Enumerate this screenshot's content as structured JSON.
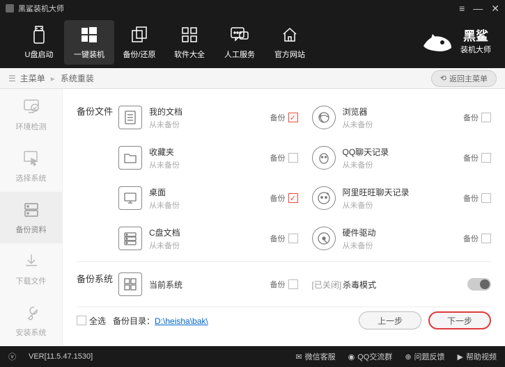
{
  "titlebar": {
    "title": "黑鲨装机大师"
  },
  "topnav": {
    "items": [
      {
        "label": "U盘启动"
      },
      {
        "label": "一键装机"
      },
      {
        "label": "备份/还原"
      },
      {
        "label": "软件大全"
      },
      {
        "label": "人工服务"
      },
      {
        "label": "官方网站"
      }
    ],
    "brand": "黑鲨",
    "brand_sub": "装机大师"
  },
  "breadcrumb": {
    "root": "主菜单",
    "current": "系统重装",
    "back": "返回主菜单"
  },
  "sidebar": {
    "items": [
      {
        "label": "环境检测"
      },
      {
        "label": "选择系统"
      },
      {
        "label": "备份资料"
      },
      {
        "label": "下载文件"
      },
      {
        "label": "安装系统"
      }
    ]
  },
  "sections": {
    "files_title": "备份文件",
    "system_title": "备份系统",
    "backup_label": "备份",
    "never": "从未备份",
    "left": [
      {
        "name": "我的文档",
        "checked": true
      },
      {
        "name": "收藏夹",
        "checked": false
      },
      {
        "name": "桌面",
        "checked": true
      },
      {
        "name": "C盘文档",
        "checked": false
      }
    ],
    "right": [
      {
        "name": "浏览器"
      },
      {
        "name": "QQ聊天记录"
      },
      {
        "name": "阿里旺旺聊天记录"
      },
      {
        "name": "硬件驱动"
      }
    ],
    "current_system": "当前系统",
    "kill_status": "[已关闭]",
    "kill_name": "杀毒模式"
  },
  "footer": {
    "select_all": "全选",
    "dir_label": "备份目录：",
    "dir_path": "D:\\heisha\\bak\\",
    "prev": "上一步",
    "next": "下一步"
  },
  "status": {
    "version": "VER[11.5.47.1530]",
    "items": [
      "微信客服",
      "QQ交流群",
      "问题反馈",
      "帮助视频"
    ]
  }
}
